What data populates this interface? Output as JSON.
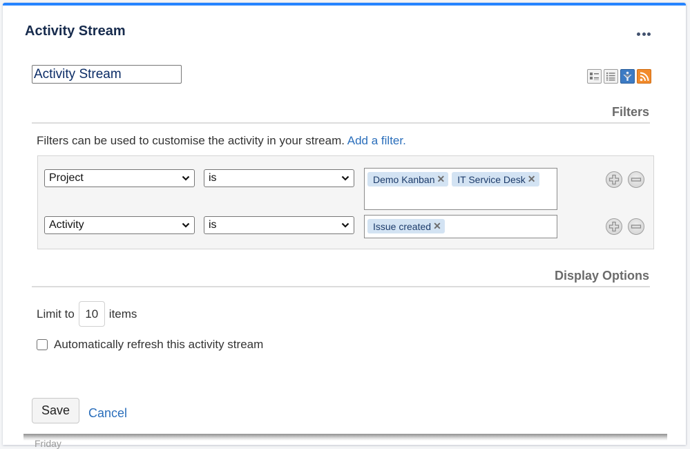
{
  "gadget": {
    "title": "Activity Stream",
    "more_menu_icon": "more-horizontal-icon"
  },
  "config": {
    "title_input_value": "Activity Stream",
    "view_icons": [
      {
        "name": "full-view-icon",
        "color": "#9a9a9a"
      },
      {
        "name": "list-view-icon",
        "color": "#9a9a9a"
      },
      {
        "name": "filter-view-icon",
        "color": "#3d7bc4"
      },
      {
        "name": "rss-feed-icon",
        "color": "#f18b2c"
      }
    ]
  },
  "filters": {
    "section_title": "Filters",
    "description": "Filters can be used to customise the activity in your stream.",
    "add_filter_link": "Add a filter.",
    "rows": [
      {
        "field": "Project",
        "operator": "is",
        "values": [
          "Demo Kanban",
          "IT Service Desk"
        ]
      },
      {
        "field": "Activity",
        "operator": "is",
        "values": [
          "Issue created"
        ]
      }
    ]
  },
  "display_options": {
    "section_title": "Display Options",
    "limit_prefix": "Limit to",
    "limit_value": "10",
    "limit_suffix": "items",
    "auto_refresh_label": "Automatically refresh this activity stream",
    "auto_refresh_checked": false
  },
  "actions": {
    "save_label": "Save",
    "cancel_label": "Cancel"
  },
  "below_fold": {
    "partial_text": "Friday"
  },
  "colors": {
    "accent": "#2684ff",
    "link": "#2a6ebb",
    "tag_bg": "#d3e3f3"
  }
}
